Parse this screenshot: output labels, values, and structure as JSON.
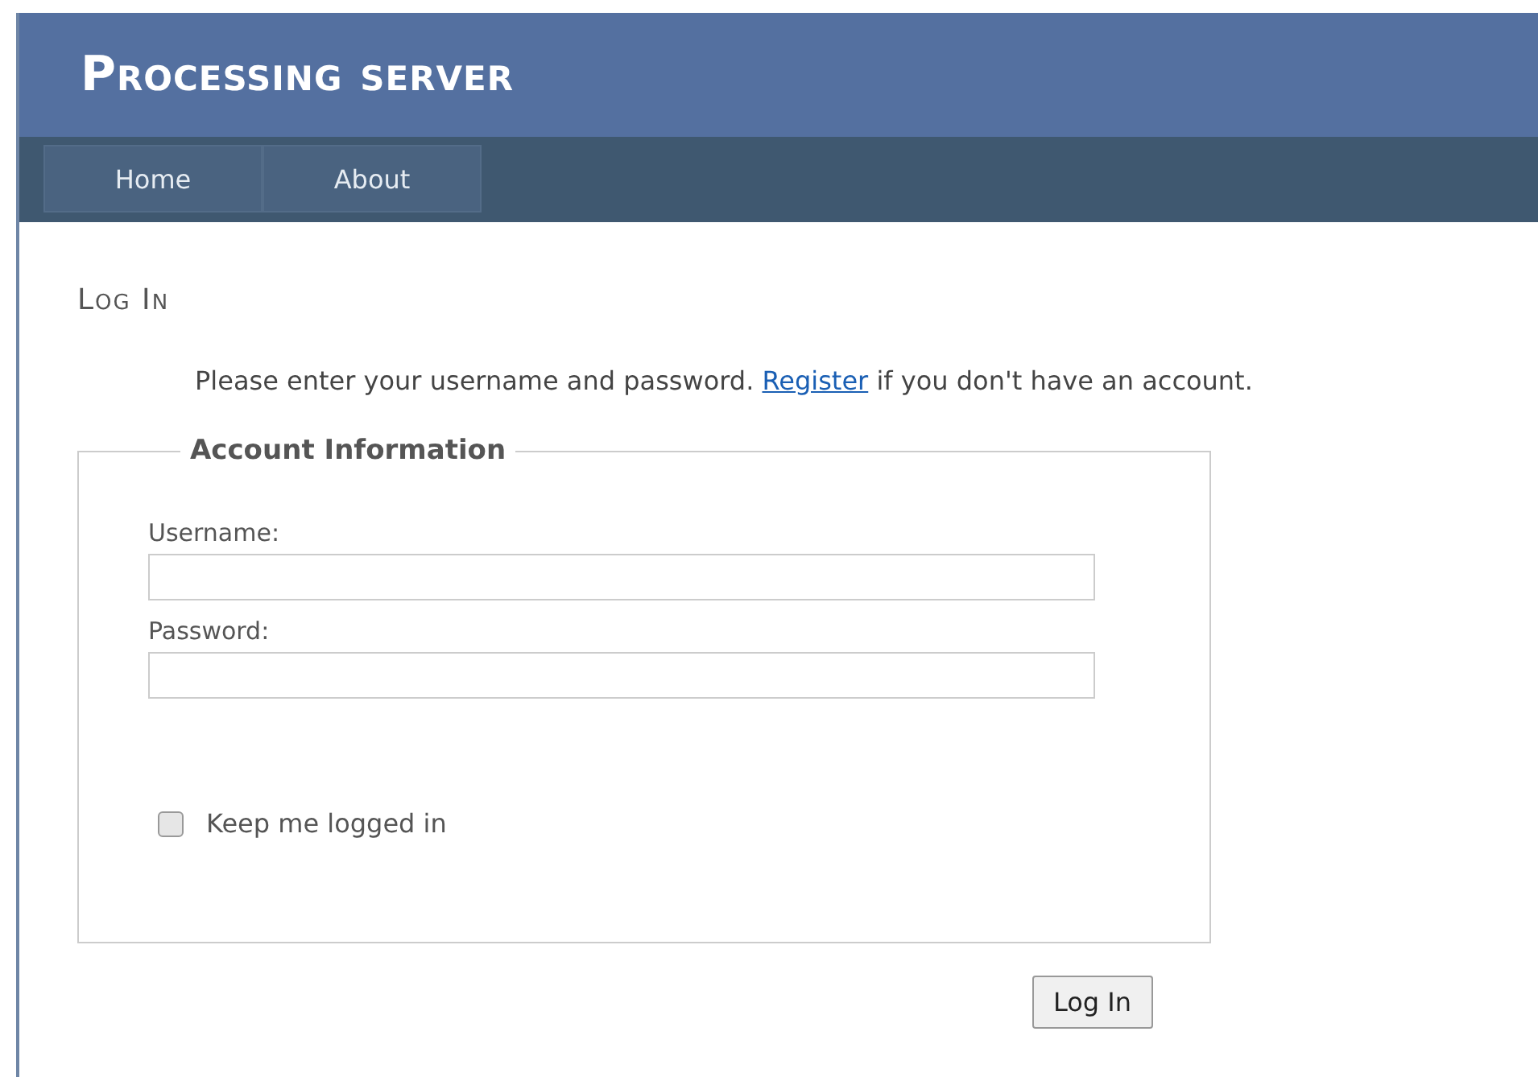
{
  "header": {
    "title": "Processing server"
  },
  "nav": [
    {
      "label": "Home"
    },
    {
      "label": "About"
    }
  ],
  "heading": "Log In",
  "intro": {
    "before": "Please enter your username and password.",
    "link": "Register",
    "after": "if you don't have an account."
  },
  "fieldset": {
    "legend": "Account Information",
    "fields": [
      {
        "label": "Username:"
      },
      {
        "label": "Password:"
      }
    ],
    "remember": {
      "label": "Keep me logged in",
      "checked": false
    }
  },
  "submit": "Log In"
}
